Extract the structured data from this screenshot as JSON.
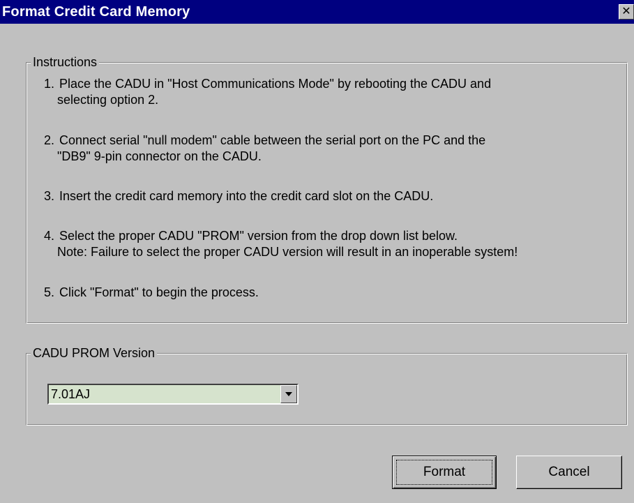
{
  "window": {
    "title": "Format Credit Card Memory",
    "close_glyph": "✕"
  },
  "instructions": {
    "label": "Instructions",
    "steps": [
      {
        "num": "1.",
        "line1": "Place the CADU in \"Host Communications Mode\" by rebooting the CADU and",
        "line2": "selecting option 2."
      },
      {
        "num": "2.",
        "line1": "Connect serial \"null modem\" cable between the serial port on the PC and the",
        "line2": "\"DB9\" 9-pin connector on the CADU."
      },
      {
        "num": "3.",
        "line1": "Insert the credit card memory into the credit card slot on the CADU."
      },
      {
        "num": "4.",
        "line1": "Select the proper CADU \"PROM\" version from the drop down list below.",
        "line2": "Note: Failure to select the proper CADU version will result in an inoperable system!"
      },
      {
        "num": "5.",
        "line1": "Click \"Format\" to begin the process."
      }
    ]
  },
  "prom": {
    "label": "CADU PROM Version",
    "selected": "7.01AJ"
  },
  "buttons": {
    "format": "Format",
    "cancel": "Cancel"
  },
  "colors": {
    "titlebar": "#000080",
    "dialog_bg": "#c0c0c0",
    "select_bg": "#d6e3cd"
  },
  "icons": {
    "close": "close-icon",
    "dropdown": "chevron-down-icon"
  }
}
